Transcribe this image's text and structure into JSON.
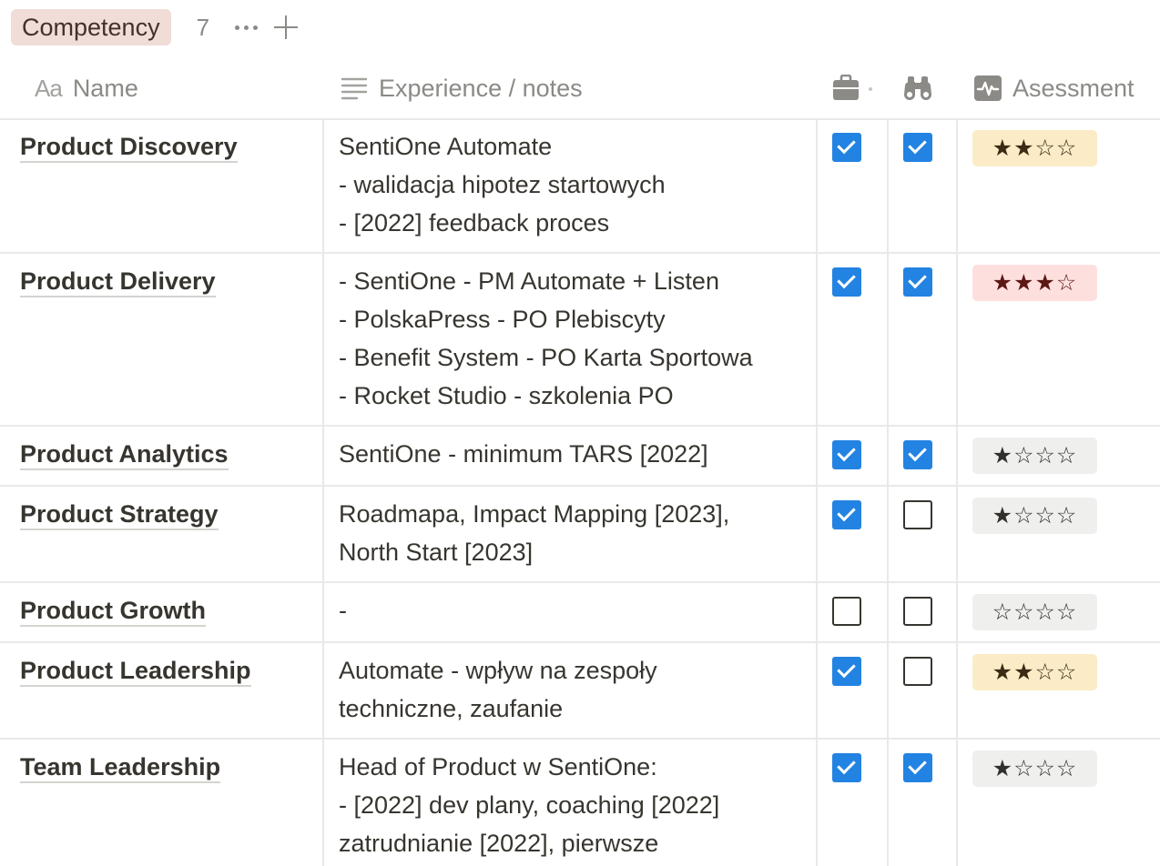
{
  "group": {
    "label": "Competency",
    "count": "7"
  },
  "header": {
    "name_prefix": "Aa",
    "name": "Name",
    "notes": "Experience / notes",
    "assessment": "Asessment"
  },
  "colors": {
    "checkbox_checked": "#2383e2",
    "tag_bg": "#f0ddd8",
    "stars_yellow": "#fbecc7",
    "stars_red": "#fde0de",
    "stars_gray": "#efefee"
  },
  "icons": {
    "name_col": "text-aa-icon",
    "notes_col": "lines-icon",
    "col1": "briefcase-icon",
    "col2": "binoculars-icon",
    "assess_col": "activity-icon"
  },
  "rows": [
    {
      "name": "Product Discovery",
      "notes": "SentiOne Automate\n- walidacja hipotez startowych\n- [2022] feedback proces",
      "c1": true,
      "c2": true,
      "stars": "★★☆☆",
      "rating": 2,
      "tone": "yellow"
    },
    {
      "name": "Product Delivery",
      "notes": "- SentiOne - PM Automate + Listen\n- PolskaPress - PO Plebiscyty\n- Benefit System - PO Karta Sportowa\n- Rocket Studio - szkolenia PO",
      "c1": true,
      "c2": true,
      "stars": "★★★☆",
      "rating": 3,
      "tone": "red"
    },
    {
      "name": "Product Analytics",
      "notes": "SentiOne - minimum TARS [2022]",
      "c1": true,
      "c2": true,
      "stars": "★☆☆☆",
      "rating": 1,
      "tone": "gray"
    },
    {
      "name": "Product Strategy",
      "notes": "Roadmapa, Impact Mapping [2023],\nNorth Start [2023]",
      "c1": true,
      "c2": false,
      "stars": "★☆☆☆",
      "rating": 1,
      "tone": "gray"
    },
    {
      "name": "Product Growth",
      "notes": "-",
      "c1": false,
      "c2": false,
      "stars": "☆☆☆☆",
      "rating": 0,
      "tone": "gray"
    },
    {
      "name": "Product Leadership",
      "notes": "Automate - wpływ na zespoły\ntechniczne, zaufanie",
      "c1": true,
      "c2": false,
      "stars": "★★☆☆",
      "rating": 2,
      "tone": "yellow"
    },
    {
      "name": "Team Leadership",
      "notes": "Head of Product w SentiOne:\n- [2022] dev plany, coaching [2022]\nzatrudnianie [2022], pierwsze",
      "c1": true,
      "c2": true,
      "stars": "★☆☆☆",
      "rating": 1,
      "tone": "gray"
    }
  ]
}
